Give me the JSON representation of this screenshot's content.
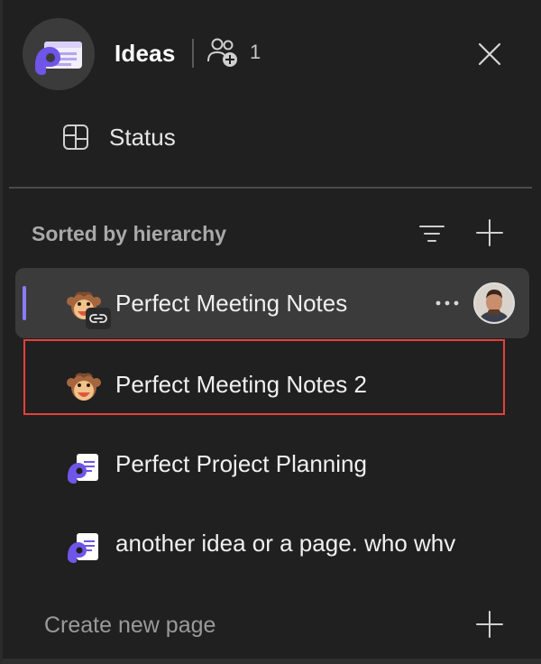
{
  "header": {
    "title": "Ideas",
    "members_count": "1",
    "app_icon": "loop-workspace-icon",
    "members_icon": "people-add-icon",
    "close_icon": "close-icon"
  },
  "status": {
    "label": "Status",
    "icon": "board-icon"
  },
  "list_header": {
    "sort_label": "Sorted by hierarchy",
    "sort_icon": "filter-icon",
    "add_icon": "plus-icon"
  },
  "pages": [
    {
      "label": "Perfect Meeting Notes",
      "icon": "monkey-emoji-icon",
      "selected": true,
      "linked": true
    },
    {
      "label": "Perfect Meeting Notes 2",
      "icon": "monkey-emoji-icon",
      "selected": false
    },
    {
      "label": "Perfect Project Planning",
      "icon": "loop-page-icon",
      "selected": false
    },
    {
      "label": "another idea or a page. who whv",
      "icon": "loop-page-icon",
      "selected": false
    }
  ],
  "footer": {
    "create_label": "Create new page",
    "add_icon": "plus-icon"
  },
  "colors": {
    "background": "#202020",
    "accent": "#8a7cf5",
    "selected_row": "#3b3b3b",
    "highlight_border": "#e5403a"
  }
}
